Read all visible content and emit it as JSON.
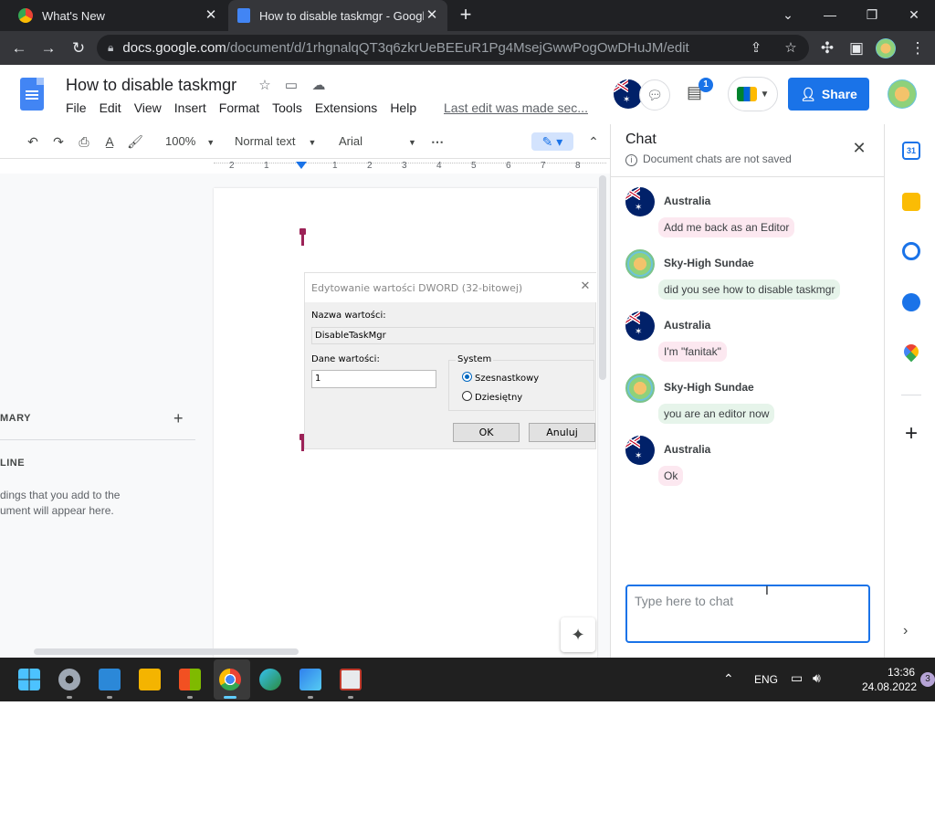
{
  "browser": {
    "tabs": [
      {
        "title": "What's New",
        "icon": "chrome-icon"
      },
      {
        "title": "How to disable taskmgr - Google",
        "icon": "docs-icon"
      }
    ],
    "address": {
      "host": "docs.google.com",
      "path": "/document/d/1rhgnalqQT3q6zkrUeBEEuR1Pg4MsejGwwPogOwDHuJM/edit"
    }
  },
  "doc": {
    "title": "How to disable taskmgr",
    "menus": [
      "File",
      "Edit",
      "View",
      "Insert",
      "Format",
      "Tools",
      "Extensions",
      "Help"
    ],
    "last_edit": "Last edit was made sec...",
    "share_label": "Share",
    "comment_badge": "1"
  },
  "toolbar": {
    "zoom": "100%",
    "style": "Normal text",
    "font": "Arial"
  },
  "ruler": {
    "ticks": [
      "2",
      "1",
      "1",
      "1",
      "2",
      "3",
      "4",
      "5",
      "6",
      "7",
      "8"
    ]
  },
  "outline": {
    "summary_label": "MARY",
    "outline_label": "LINE",
    "hint_line1": "dings that you add to the",
    "hint_line2": "ument will appear here."
  },
  "dialog": {
    "title": "Edytowanie wartości DWORD (32-bitowej)",
    "name_label": "Nazwa wartości:",
    "name_value": "DisableTaskMgr",
    "data_label": "Dane wartości:",
    "data_value": "1",
    "system_label": "System",
    "radio_hex": "Szesnastkowy",
    "radio_dec": "Dziesiętny",
    "ok": "OK",
    "cancel": "Anuluj"
  },
  "chat": {
    "title": "Chat",
    "note": "Document chats are not saved",
    "messages": [
      {
        "author": "Australia",
        "text": "Add me back as an Editor"
      },
      {
        "author": "Sky-High Sundae",
        "text": "did you see how to disable taskmgr"
      },
      {
        "author": "Australia",
        "text": "I'm \"fanitak\""
      },
      {
        "author": "Sky-High Sundae",
        "text": "you are an editor now"
      },
      {
        "author": "Australia",
        "text": "Ok"
      }
    ],
    "input_placeholder": "Type here to chat"
  },
  "taskbar": {
    "lang": "ENG",
    "time": "13:36",
    "date": "24.08.2022",
    "notifications": "3"
  },
  "colors": {
    "brand_blue": "#1a73e8",
    "australia_bubble": "#fce8f0",
    "sky_bubble": "#e6f4ea",
    "chrome_dark": "#202124"
  }
}
